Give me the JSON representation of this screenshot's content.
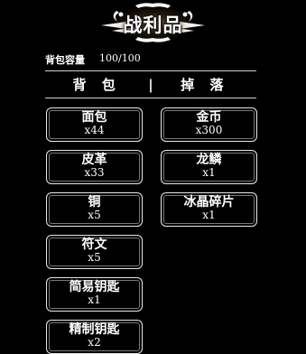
{
  "header": {
    "title": "战利品"
  },
  "capacity": {
    "label": "背包容量",
    "value": "100/100"
  },
  "tabs": {
    "backpack": "背 包",
    "separator": "|",
    "drops": "掉 落"
  },
  "backpack_items": [
    {
      "name": "面包",
      "qty": "x44"
    },
    {
      "name": "皮革",
      "qty": "x33"
    },
    {
      "name": "铜",
      "qty": "x5"
    },
    {
      "name": "符文",
      "qty": "x5"
    },
    {
      "name": "简易钥匙",
      "qty": "x1"
    },
    {
      "name": "精制钥匙",
      "qty": "x2"
    }
  ],
  "drop_items": [
    {
      "name": "金币",
      "qty": "x300"
    },
    {
      "name": "龙鳞",
      "qty": "x1"
    },
    {
      "name": "冰晶碎片",
      "qty": "x1"
    }
  ],
  "colors": {
    "background": "#000000",
    "text": "#ffffff",
    "border": "#e8e8e8",
    "title_glow": "#c8aa50"
  }
}
